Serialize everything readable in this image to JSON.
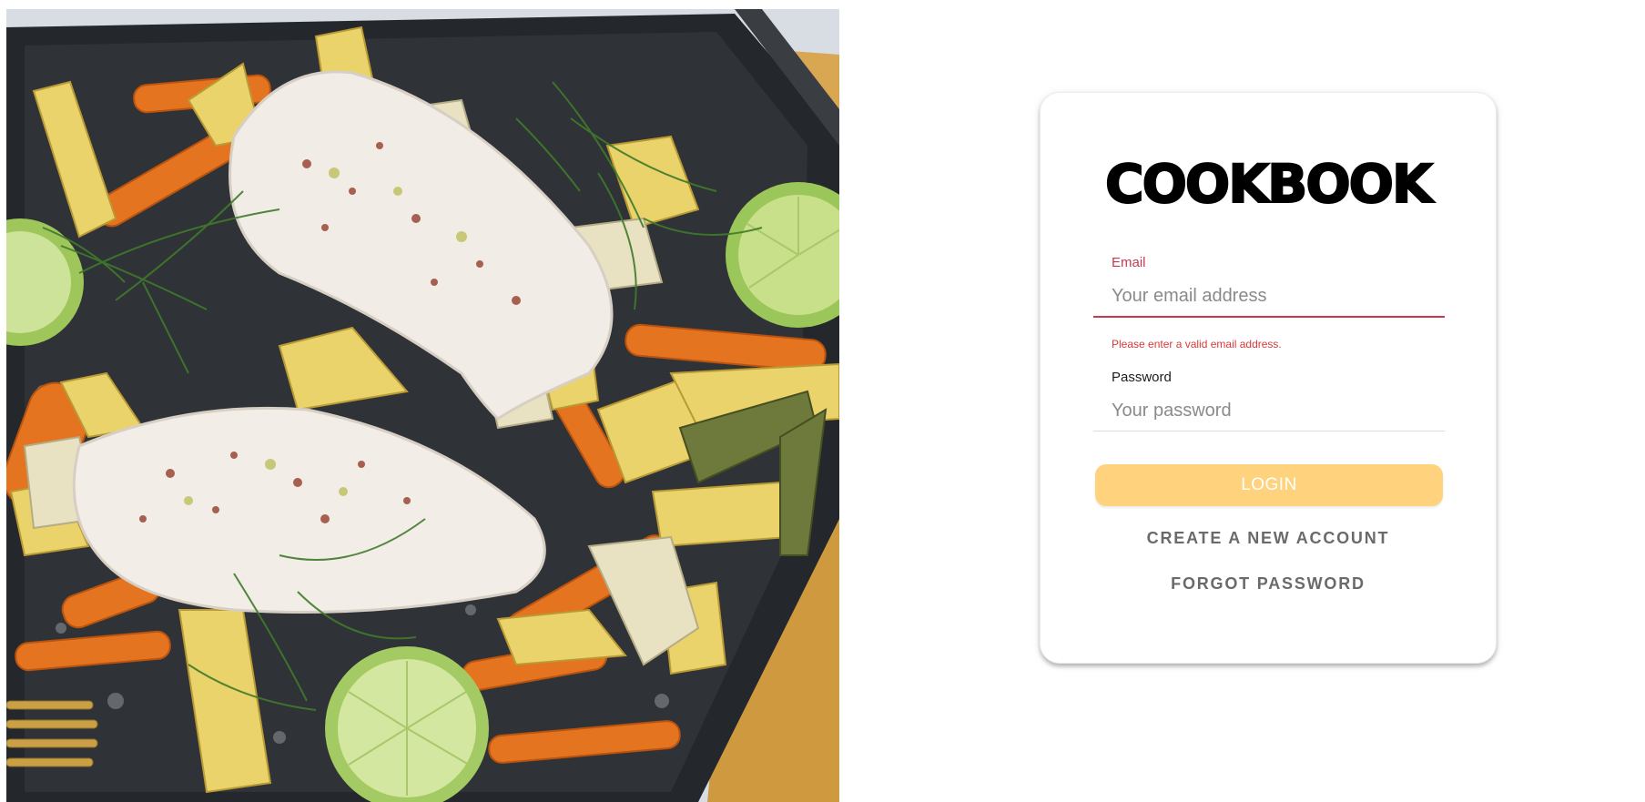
{
  "photo": {
    "alt": "Baked fish fillets with roasted carrots, potatoes, fennel, dill and lime"
  },
  "login_card": {
    "brand_title": "COOKBOOK",
    "email": {
      "label": "Email",
      "placeholder": "Your email address",
      "value": "",
      "error": "Please enter a valid email address."
    },
    "password": {
      "label": "Password",
      "placeholder": "Your password",
      "value": ""
    },
    "login_label": "LOGIN",
    "create_account_label": "CREATE A NEW ACCOUNT",
    "forgot_password_label": "FORGOT PASSWORD"
  },
  "colors": {
    "error": "#c8384f",
    "login_button": "#ffd27d",
    "secondary_text": "#6a6a6a"
  }
}
